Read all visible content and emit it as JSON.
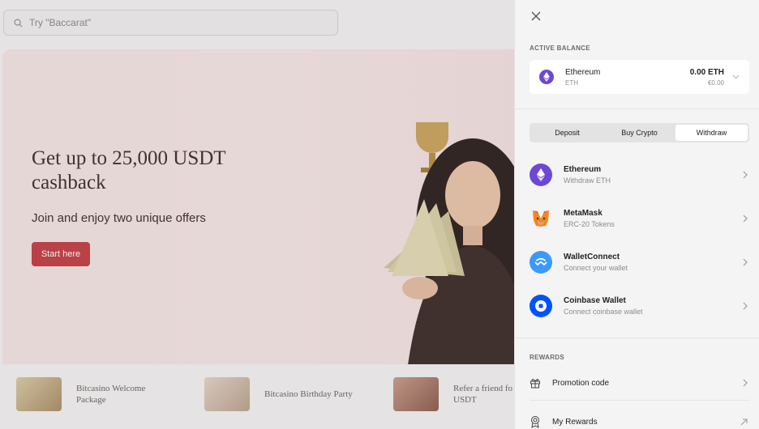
{
  "search": {
    "placeholder": "Try \"Baccarat\""
  },
  "hero": {
    "title": "Get up to 25,000 USDT cashback",
    "subtitle": "Join and enjoy two unique offers",
    "cta": "Start here"
  },
  "promos": [
    {
      "label": "Bitcasino Welcome Package"
    },
    {
      "label": "Bitcasino Birthday Party"
    },
    {
      "label": "Refer a friend fo USDT"
    }
  ],
  "drawer": {
    "active_balance_label": "ACTIVE BALANCE",
    "balance": {
      "name": "Ethereum",
      "symbol": "ETH",
      "amount": "0.00 ETH",
      "fiat": "€0.00"
    },
    "tabs": [
      {
        "label": "Deposit",
        "active": false
      },
      {
        "label": "Buy Crypto",
        "active": false
      },
      {
        "label": "Withdraw",
        "active": true
      }
    ],
    "methods": [
      {
        "name": "Ethereum",
        "sub": "Withdraw ETH",
        "icon": "ethereum-icon"
      },
      {
        "name": "MetaMask",
        "sub": "ERC-20 Tokens",
        "icon": "metamask-icon"
      },
      {
        "name": "WalletConnect",
        "sub": "Connect your wallet",
        "icon": "walletconnect-icon"
      },
      {
        "name": "Coinbase Wallet",
        "sub": "Connect coinbase wallet",
        "icon": "coinbase-icon"
      }
    ],
    "rewards_label": "REWARDS",
    "rewards": [
      {
        "label": "Promotion code",
        "icon": "gift-icon"
      },
      {
        "label": "My Rewards",
        "icon": "badge-icon"
      }
    ]
  },
  "colors": {
    "accent": "#c23b41",
    "eth": "#6b49d6",
    "walletconnect": "#3b99fc",
    "coinbase": "#0052ff"
  }
}
